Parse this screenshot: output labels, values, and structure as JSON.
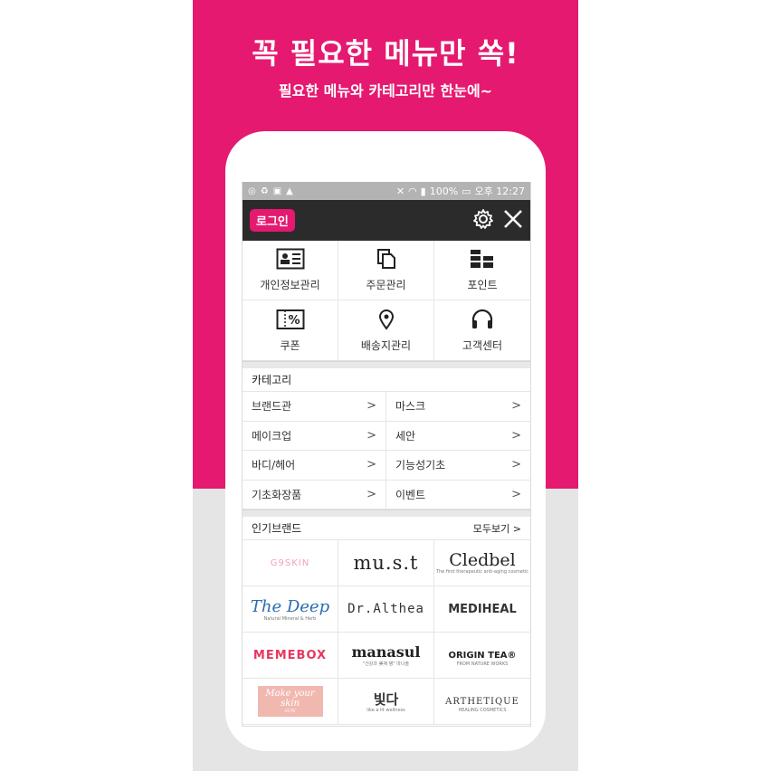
{
  "promo": {
    "headline": "꼭 필요한 메뉴만 쏙!",
    "subline": "필요한 메뉴와 카테고리만 한눈에~",
    "colors": {
      "accent": "#e5196f",
      "background": "#e5e5e5"
    }
  },
  "statusbar": {
    "battery": "100%",
    "time": "오후 12:27"
  },
  "topbar": {
    "login_label": "로그인",
    "icons": [
      "gear-icon",
      "close-icon"
    ]
  },
  "quick_menu": [
    {
      "label": "개인정보관리",
      "icon": "id-card-icon"
    },
    {
      "label": "주문관리",
      "icon": "documents-icon"
    },
    {
      "label": "포인트",
      "icon": "coins-icon"
    },
    {
      "label": "쿠폰",
      "icon": "coupon-icon"
    },
    {
      "label": "배송지관리",
      "icon": "location-pin-icon"
    },
    {
      "label": "고객센터",
      "icon": "headset-icon"
    }
  ],
  "category": {
    "title": "카테고리",
    "items": [
      "브랜드관",
      "마스크",
      "메이크업",
      "세안",
      "바디/헤어",
      "기능성기초",
      "기초화장품",
      "이벤트"
    ]
  },
  "brands": {
    "title": "인기브랜드",
    "see_all": "모두보기",
    "items": [
      {
        "name": "G9SKIN"
      },
      {
        "name": "mu.s.t"
      },
      {
        "name": "Cledbel",
        "tagline": "The first therapeutic anti-aging cosmetic"
      },
      {
        "name": "The Deep",
        "tagline": "Natural Mineral & Herb"
      },
      {
        "name": "Dr.Althea"
      },
      {
        "name": "MEDIHEAL"
      },
      {
        "name": "MEMEBOX"
      },
      {
        "name": "manasul",
        "tagline": "\"건강과 美에 병\" 마나솔"
      },
      {
        "name": "ORIGIN TEA®",
        "tagline": "FROM NATURE WORKS"
      },
      {
        "name": "Make your skin",
        "tagline": "SUN"
      },
      {
        "name": "빛다",
        "tagline": "like a lit wellness"
      },
      {
        "name": "ARTHETIQUE",
        "tagline": "HEALING COSMETICS"
      }
    ]
  }
}
